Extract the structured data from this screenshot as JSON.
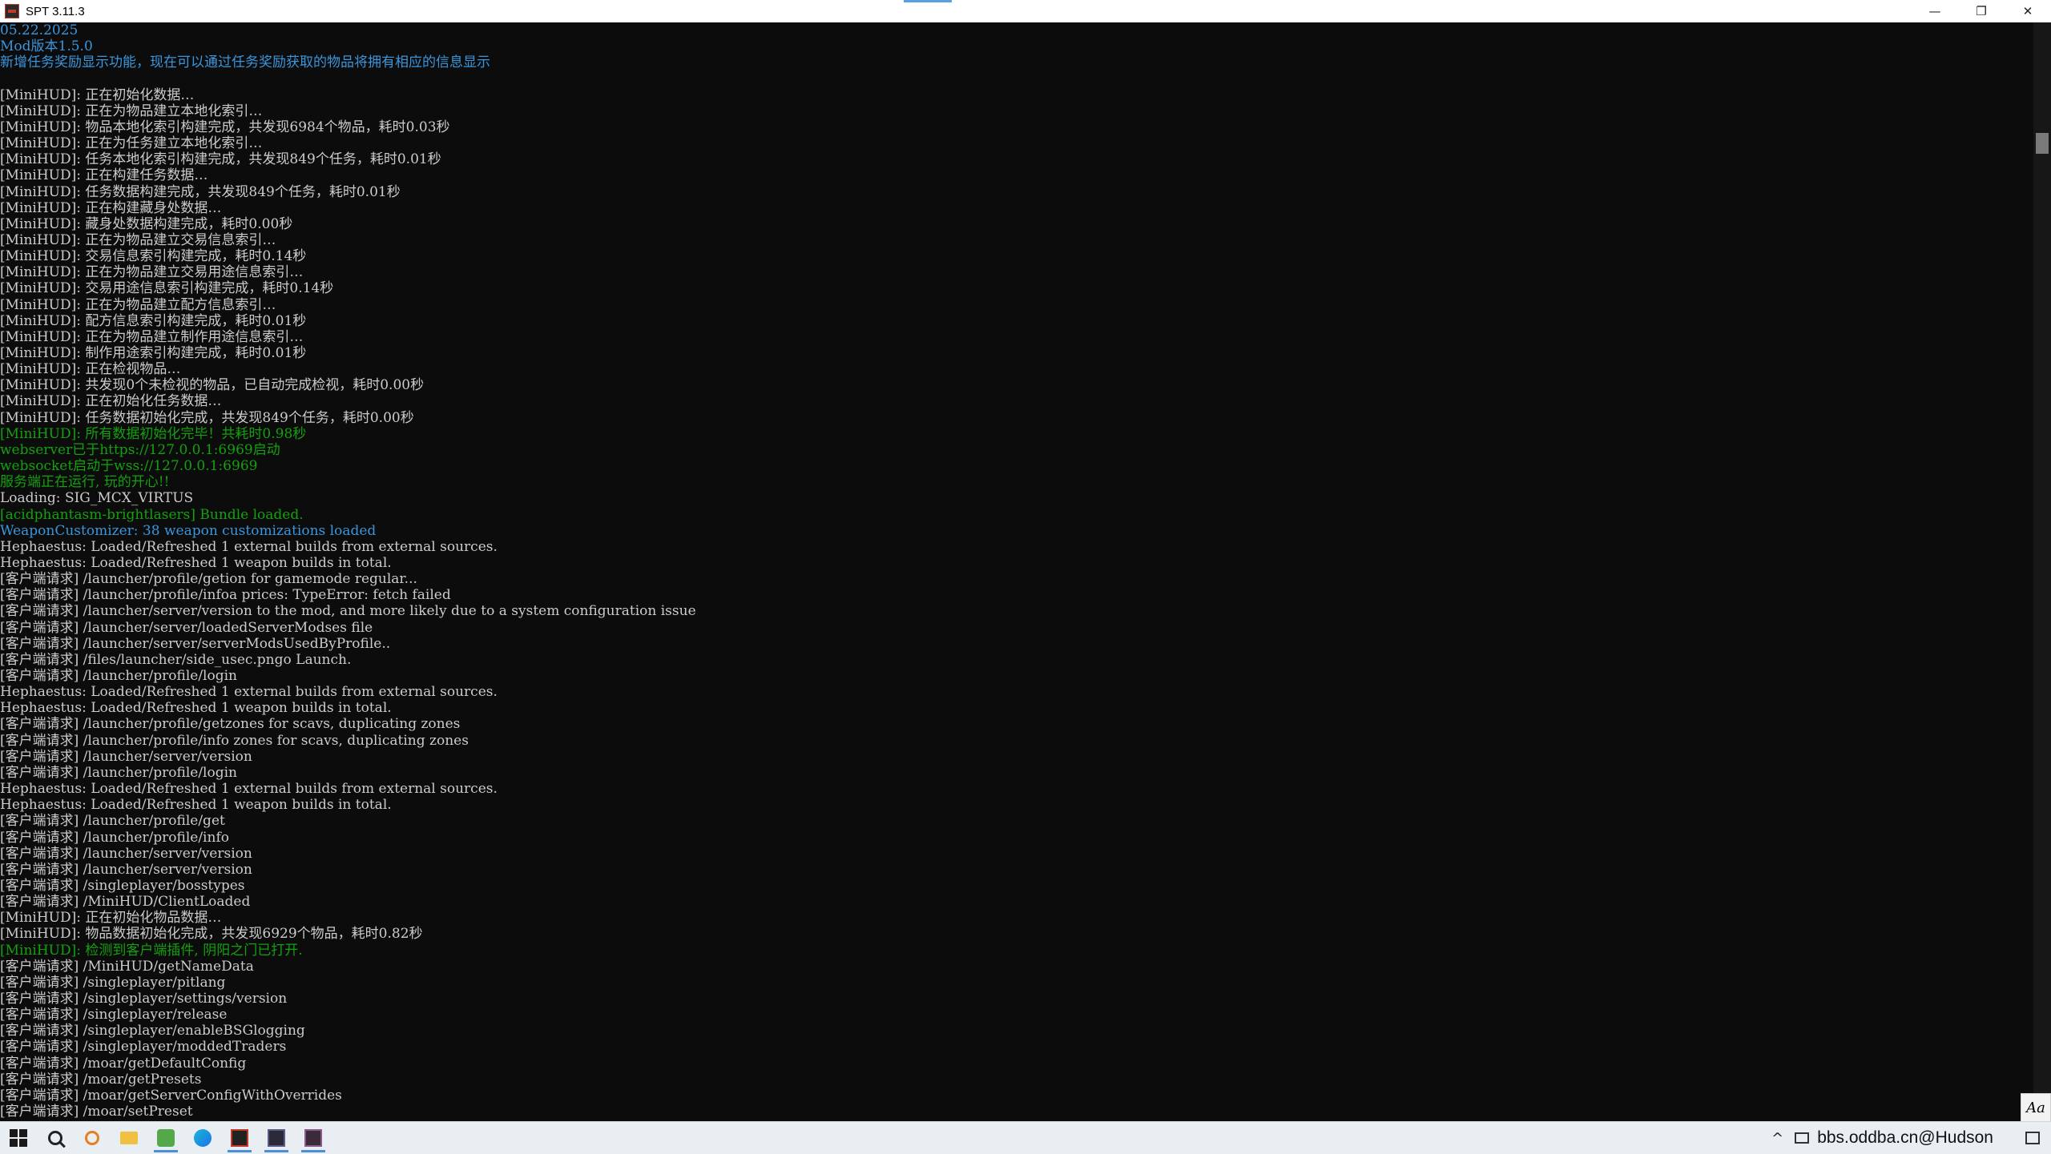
{
  "window": {
    "title": "SPT 3.11.3",
    "controls": {
      "minimize": "—",
      "maximize": "❐",
      "close": "✕"
    }
  },
  "console": {
    "lines": [
      {
        "text": "05.22.2025",
        "color": "blue"
      },
      {
        "text": "Mod版本1.5.0",
        "color": "blue"
      },
      {
        "text": "新增任务奖励显示功能，现在可以通过任务奖励获取的物品将拥有相应的信息显示",
        "color": "blue"
      },
      {
        "text": "",
        "color": "white"
      },
      {
        "text": "[MiniHUD]: 正在初始化数据…",
        "color": "white"
      },
      {
        "text": "[MiniHUD]: 正在为物品建立本地化索引…",
        "color": "white"
      },
      {
        "text": "[MiniHUD]: 物品本地化索引构建完成，共发现6984个物品，耗时0.03秒",
        "color": "white"
      },
      {
        "text": "[MiniHUD]: 正在为任务建立本地化索引…",
        "color": "white"
      },
      {
        "text": "[MiniHUD]: 任务本地化索引构建完成，共发现849个任务，耗时0.01秒",
        "color": "white"
      },
      {
        "text": "[MiniHUD]: 正在构建任务数据…",
        "color": "white"
      },
      {
        "text": "[MiniHUD]: 任务数据构建完成，共发现849个任务，耗时0.01秒",
        "color": "white"
      },
      {
        "text": "[MiniHUD]: 正在构建藏身处数据…",
        "color": "white"
      },
      {
        "text": "[MiniHUD]: 藏身处数据构建完成，耗时0.00秒",
        "color": "white"
      },
      {
        "text": "[MiniHUD]: 正在为物品建立交易信息索引…",
        "color": "white"
      },
      {
        "text": "[MiniHUD]: 交易信息索引构建完成，耗时0.14秒",
        "color": "white"
      },
      {
        "text": "[MiniHUD]: 正在为物品建立交易用途信息索引…",
        "color": "white"
      },
      {
        "text": "[MiniHUD]: 交易用途信息索引构建完成，耗时0.14秒",
        "color": "white"
      },
      {
        "text": "[MiniHUD]: 正在为物品建立配方信息索引…",
        "color": "white"
      },
      {
        "text": "[MiniHUD]: 配方信息索引构建完成，耗时0.01秒",
        "color": "white"
      },
      {
        "text": "[MiniHUD]: 正在为物品建立制作用途信息索引…",
        "color": "white"
      },
      {
        "text": "[MiniHUD]: 制作用途索引构建完成，耗时0.01秒",
        "color": "white"
      },
      {
        "text": "[MiniHUD]: 正在检视物品…",
        "color": "white"
      },
      {
        "text": "[MiniHUD]: 共发现0个未检视的物品，已自动完成检视，耗时0.00秒",
        "color": "white"
      },
      {
        "text": "[MiniHUD]: 正在初始化任务数据…",
        "color": "white"
      },
      {
        "text": "[MiniHUD]: 任务数据初始化完成，共发现849个任务，耗时0.00秒",
        "color": "white"
      },
      {
        "text": "[MiniHUD]: 所有数据初始化完毕！共耗时0.98秒",
        "color": "green"
      },
      {
        "text": "webserver已于https://127.0.0.1:6969启动",
        "color": "green"
      },
      {
        "text": "websocket启动于wss://127.0.0.1:6969",
        "color": "green"
      },
      {
        "text": "服务端正在运行, 玩的开心!!",
        "color": "green"
      },
      {
        "text": "Loading: SIG_MCX_VIRTUS",
        "color": "white"
      },
      {
        "text": "[acidphantasm-brightlasers] Bundle loaded.",
        "color": "green"
      },
      {
        "text": "WeaponCustomizer: 38 weapon customizations loaded",
        "color": "blue"
      },
      {
        "text": "Hephaestus: Loaded/Refreshed 1 external builds from external sources.",
        "color": "white"
      },
      {
        "text": "Hephaestus: Loaded/Refreshed 1 weapon builds in total.",
        "color": "white"
      },
      {
        "text": "[客户端请求] /launcher/profile/getion for gamemode regular...",
        "color": "white"
      },
      {
        "text": "[客户端请求] /launcher/profile/infoa prices: TypeError: fetch failed",
        "color": "white"
      },
      {
        "text": "[客户端请求] /launcher/server/version to the mod, and more likely due to a system configuration issue",
        "color": "white"
      },
      {
        "text": "[客户端请求] /launcher/server/loadedServerModses file",
        "color": "white"
      },
      {
        "text": "[客户端请求] /launcher/server/serverModsUsedByProfile..",
        "color": "white"
      },
      {
        "text": "[客户端请求] /files/launcher/side_usec.pngo Launch.",
        "color": "white"
      },
      {
        "text": "[客户端请求] /launcher/profile/login",
        "color": "white"
      },
      {
        "text": "Hephaestus: Loaded/Refreshed 1 external builds from external sources.",
        "color": "white"
      },
      {
        "text": "Hephaestus: Loaded/Refreshed 1 weapon builds in total.",
        "color": "white"
      },
      {
        "text": "[客户端请求] /launcher/profile/getzones for scavs, duplicating zones",
        "color": "white"
      },
      {
        "text": "[客户端请求] /launcher/profile/info zones for scavs, duplicating zones",
        "color": "white"
      },
      {
        "text": "[客户端请求] /launcher/server/version",
        "color": "white"
      },
      {
        "text": "[客户端请求] /launcher/profile/login",
        "color": "white"
      },
      {
        "text": "Hephaestus: Loaded/Refreshed 1 external builds from external sources.",
        "color": "white"
      },
      {
        "text": "Hephaestus: Loaded/Refreshed 1 weapon builds in total.",
        "color": "white"
      },
      {
        "text": "[客户端请求] /launcher/profile/get",
        "color": "white"
      },
      {
        "text": "[客户端请求] /launcher/profile/info",
        "color": "white"
      },
      {
        "text": "[客户端请求] /launcher/server/version",
        "color": "white"
      },
      {
        "text": "[客户端请求] /launcher/server/version",
        "color": "white"
      },
      {
        "text": "[客户端请求] /singleplayer/bosstypes",
        "color": "white"
      },
      {
        "text": "[客户端请求] /MiniHUD/ClientLoaded",
        "color": "white"
      },
      {
        "text": "[MiniHUD]: 正在初始化物品数据…",
        "color": "white"
      },
      {
        "text": "[MiniHUD]: 物品数据初始化完成，共发现6929个物品，耗时0.82秒",
        "color": "white"
      },
      {
        "text": "[MiniHUD]: 检测到客户端插件, 阴阳之门已打开.",
        "color": "green"
      },
      {
        "text": "[客户端请求] /MiniHUD/getNameData",
        "color": "white"
      },
      {
        "text": "[客户端请求] /singleplayer/pitlang",
        "color": "white"
      },
      {
        "text": "[客户端请求] /singleplayer/settings/version",
        "color": "white"
      },
      {
        "text": "[客户端请求] /singleplayer/release",
        "color": "white"
      },
      {
        "text": "[客户端请求] /singleplayer/enableBSGlogging",
        "color": "white"
      },
      {
        "text": "[客户端请求] /singleplayer/moddedTraders",
        "color": "white"
      },
      {
        "text": "[客户端请求] /moar/getDefaultConfig",
        "color": "white"
      },
      {
        "text": "[客户端请求] /moar/getPresets",
        "color": "white"
      },
      {
        "text": "[客户端请求] /moar/getServerConfigWithOverrides",
        "color": "white"
      },
      {
        "text": "[客户端请求] /moar/setPreset",
        "color": "white"
      }
    ]
  },
  "aa_label": "Aa",
  "taskbar": {
    "items": [
      {
        "name": "start-button",
        "icon": "windows-logo-icon"
      },
      {
        "name": "search-button",
        "icon": "search-icon"
      },
      {
        "name": "everything-app",
        "icon": "everything-search-icon"
      },
      {
        "name": "file-explorer-app",
        "icon": "folder-icon"
      },
      {
        "name": "green-app",
        "icon": "app-icon"
      },
      {
        "name": "edge-app",
        "icon": "edge-browser-icon"
      },
      {
        "name": "spt-server-app",
        "icon": "spt-icon"
      },
      {
        "name": "spt-launcher-app",
        "icon": "spt-icon"
      },
      {
        "name": "game-app",
        "icon": "game-icon"
      }
    ],
    "tray_chevron": "^",
    "watermark": "bbs.oddba.cn@Hudson"
  }
}
